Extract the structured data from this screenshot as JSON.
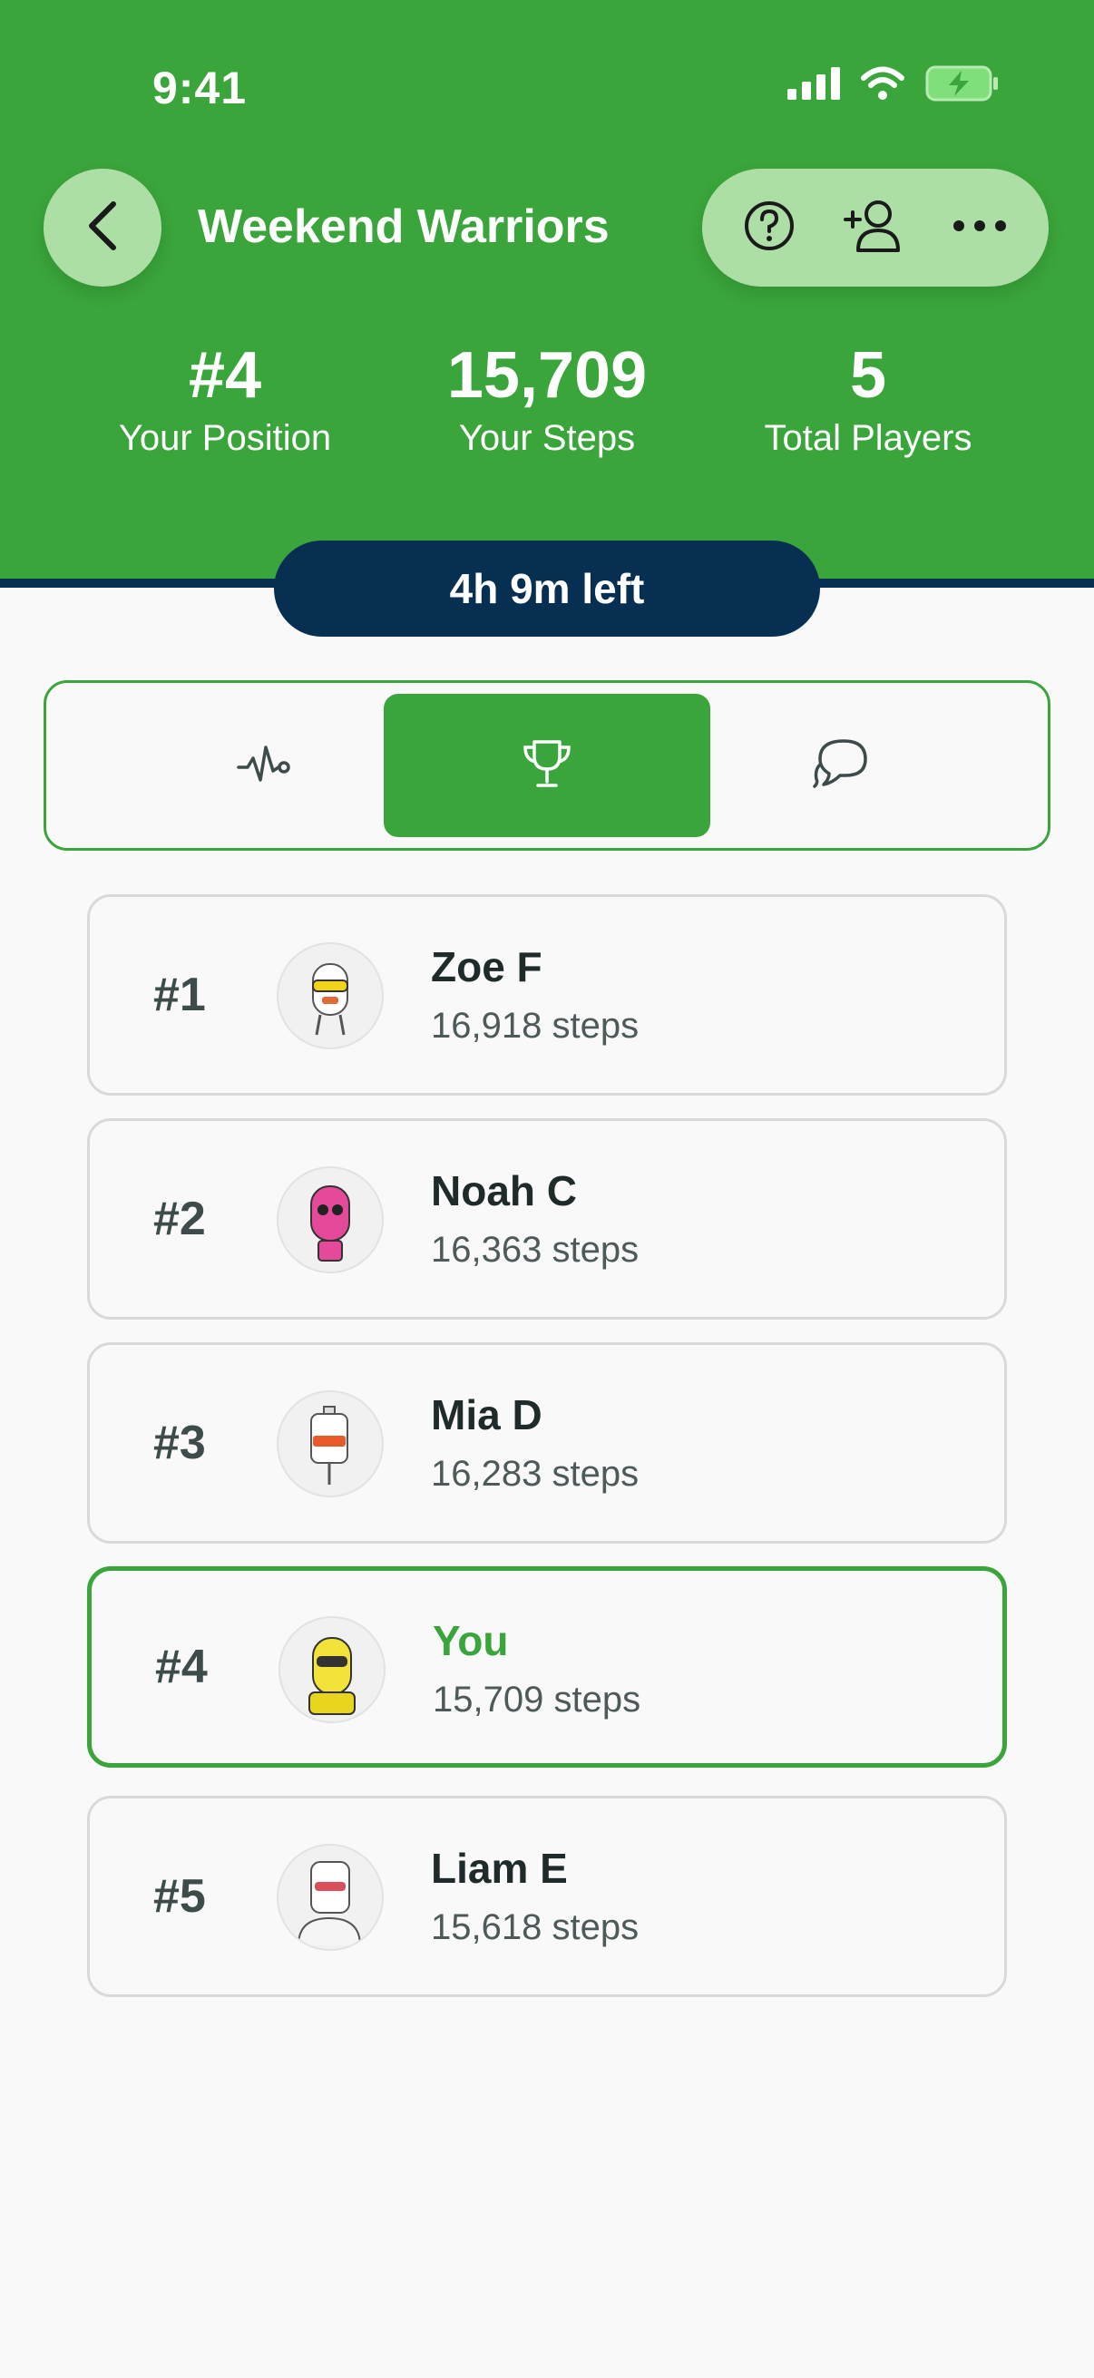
{
  "status": {
    "time": "9:41"
  },
  "header": {
    "title": "Weekend Warriors"
  },
  "stats": [
    {
      "value": "#4",
      "label": "Your Position"
    },
    {
      "value": "15,709",
      "label": "Your Steps"
    },
    {
      "value": "5",
      "label": "Total Players"
    }
  ],
  "timer": "4h 9m left",
  "tabs": [
    {
      "icon": "activity-icon",
      "active": false
    },
    {
      "icon": "trophy-icon",
      "active": true
    },
    {
      "icon": "chat-icon",
      "active": false
    }
  ],
  "leaderboard": [
    {
      "rank": "#1",
      "name": "Zoe F",
      "steps": "16,918 steps",
      "avatar_color": "#ffffff"
    },
    {
      "rank": "#2",
      "name": "Noah C",
      "steps": "16,363 steps",
      "avatar_color": "#e54a9a"
    },
    {
      "rank": "#3",
      "name": "Mia D",
      "steps": "16,283 steps",
      "avatar_color": "#ffffff"
    },
    {
      "rank": "#4",
      "name": "You",
      "steps": "15,709 steps",
      "avatar_color": "#f3e23a",
      "is_me": true
    },
    {
      "rank": "#5",
      "name": "Liam E",
      "steps": "15,618 steps",
      "avatar_color": "#ffffff"
    }
  ],
  "colors": {
    "brand_green": "#3aa53a",
    "navy": "#062f52",
    "pill_green": "#acdea6"
  }
}
